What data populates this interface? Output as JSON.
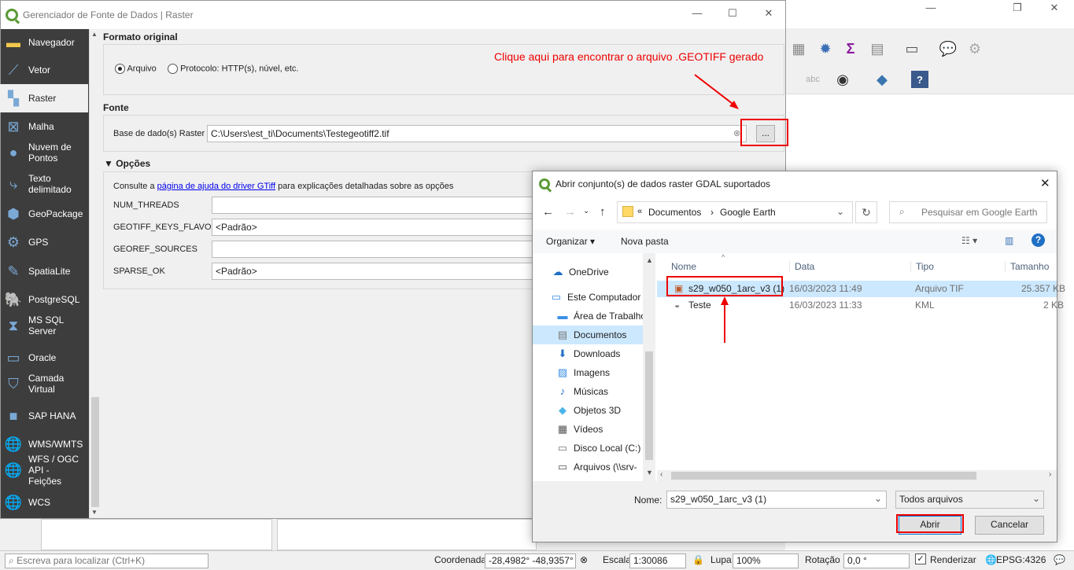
{
  "main_dialog": {
    "title": "Gerenciador de Fonte de Dados | Raster",
    "sidebar": [
      {
        "label": "Navegador",
        "icon": "folder-icon"
      },
      {
        "label": "Vetor",
        "icon": "vector-icon"
      },
      {
        "label": "Raster",
        "icon": "raster-icon"
      },
      {
        "label": "Malha",
        "icon": "mesh-icon"
      },
      {
        "label": "Nuvem de Pontos",
        "icon": "point-cloud-icon"
      },
      {
        "label": "Texto delimitado",
        "icon": "delimited-text-icon"
      },
      {
        "label": "GeoPackage",
        "icon": "geopackage-icon"
      },
      {
        "label": "GPS",
        "icon": "gps-icon"
      },
      {
        "label": "SpatiaLite",
        "icon": "spatialite-icon"
      },
      {
        "label": "PostgreSQL",
        "icon": "postgresql-icon"
      },
      {
        "label": "MS SQL Server",
        "icon": "mssql-icon"
      },
      {
        "label": "Oracle",
        "icon": "oracle-icon"
      },
      {
        "label": "Camada Virtual",
        "icon": "virtual-layer-icon"
      },
      {
        "label": "SAP HANA",
        "icon": "sap-hana-icon"
      },
      {
        "label": "WMS/WMTS",
        "icon": "wms-icon"
      },
      {
        "label": "WFS / OGC API - Feições",
        "icon": "wfs-icon"
      },
      {
        "label": "WCS",
        "icon": "wcs-icon"
      }
    ],
    "formato_original": {
      "heading": "Formato original",
      "radio_arquivo": "Arquivo",
      "radio_protocolo": "Protocolo: HTTP(s), núvel, etc.",
      "selected": "Arquivo"
    },
    "annotation": "Clique aqui para encontrar o arquivo .GEOTIFF gerado",
    "fonte": {
      "heading": "Fonte",
      "label": "Base de dado(s) Raster",
      "value": "C:\\Users\\est_ti\\Documents\\Testegeotiff2.tif",
      "browse_label": "..."
    },
    "opcoes": {
      "heading": "Opções",
      "help_prefix": "Consulte a ",
      "help_link": "página de ajuda do driver GTiff",
      "help_suffix": " para explicações detalhadas sobre as opções",
      "rows": [
        {
          "label": "NUM_THREADS",
          "value": ""
        },
        {
          "label": "GEOTIFF_KEYS_FLAVOR",
          "value": "<Padrão>"
        },
        {
          "label": "GEOREF_SOURCES",
          "value": ""
        },
        {
          "label": "SPARSE_OK",
          "value": "<Padrão>"
        }
      ]
    }
  },
  "file_dialog": {
    "title": "Abrir conjunto(s) de dados raster GDAL suportados",
    "breadcrumb": [
      "Documentos",
      "Google Earth"
    ],
    "search_placeholder": "Pesquisar em Google Earth",
    "organize_label": "Organizar",
    "new_folder_label": "Nova pasta",
    "tree": [
      {
        "label": "OneDrive",
        "icon": "cloud-icon"
      },
      {
        "label": "Este Computador",
        "icon": "computer-icon"
      },
      {
        "label": "Área de Trabalho",
        "icon": "desktop-icon"
      },
      {
        "label": "Documentos",
        "icon": "documents-icon"
      },
      {
        "label": "Downloads",
        "icon": "download-icon"
      },
      {
        "label": "Imagens",
        "icon": "images-icon"
      },
      {
        "label": "Músicas",
        "icon": "music-icon"
      },
      {
        "label": "Objetos 3D",
        "icon": "cube-icon"
      },
      {
        "label": "Vídeos",
        "icon": "video-icon"
      },
      {
        "label": "Disco Local (C:)",
        "icon": "disk-icon"
      },
      {
        "label": "Arquivos (\\\\srv-",
        "icon": "network-drive-icon"
      }
    ],
    "columns": [
      "Nome",
      "Data",
      "Tipo",
      "Tamanho"
    ],
    "files": [
      {
        "name": "s29_w050_1arc_v3 (1)",
        "date": "16/03/2023 11:49",
        "type": "Arquivo TIF",
        "size": "25.357 KB"
      },
      {
        "name": "Teste",
        "date": "16/03/2023 11:33",
        "type": "KML",
        "size": "2 KB"
      }
    ],
    "name_label": "Nome:",
    "name_value": "s29_w050_1arc_v3 (1)",
    "filter_value": "Todos arquivos",
    "open_label": "Abrir",
    "cancel_label": "Cancelar"
  },
  "statusbar": {
    "search_placeholder": "Escreva para localizar (Ctrl+K)",
    "coord_label": "Coordenada",
    "coord_value": "-28,4982° -48,9357°",
    "scale_label": "Escala",
    "scale_value": "1:30086",
    "zoom_label": "Lupa",
    "zoom_value": "100%",
    "rotation_label": "Rotação",
    "rotation_value": "0,0 °",
    "render_label": "Renderizar",
    "epsg": "EPSG:4326"
  }
}
